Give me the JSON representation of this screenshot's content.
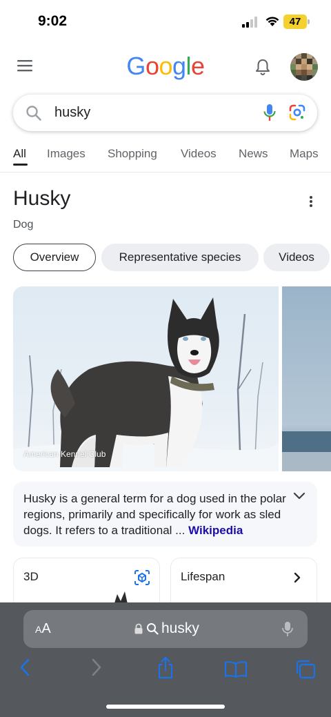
{
  "status_bar": {
    "time": "9:02",
    "battery": "47",
    "battery_color": "#f5d130"
  },
  "header": {
    "logo_letters": [
      "G",
      "o",
      "o",
      "g",
      "l",
      "e"
    ],
    "logo_colors": [
      "#4285f4",
      "#ea4335",
      "#fbbc05",
      "#4285f4",
      "#34a853",
      "#ea4335"
    ],
    "menu_icon": "hamburger-menu-icon",
    "notification_icon": "bell-icon",
    "avatar_icon": "profile-avatar"
  },
  "search": {
    "query": "husky",
    "search_icon": "magnifier-icon",
    "voice_icon": "microphone-icon",
    "lens_icon": "google-lens-icon"
  },
  "tabs": [
    {
      "label": "All",
      "active": true
    },
    {
      "label": "Images",
      "active": false
    },
    {
      "label": "Shopping",
      "active": false
    },
    {
      "label": "Videos",
      "active": false
    },
    {
      "label": "News",
      "active": false
    },
    {
      "label": "Maps",
      "active": false
    }
  ],
  "knowledge_panel": {
    "title": "Husky",
    "subtitle": "Dog",
    "chips": [
      {
        "label": "Overview",
        "selected": true
      },
      {
        "label": "Representative species",
        "selected": false
      },
      {
        "label": "Videos",
        "selected": false
      }
    ],
    "image_credit": "American Kennel Club",
    "description": "Husky is a general term for a dog used in the polar regions, primarily and specifically for work as sled dogs. It refers to a traditional",
    "description_ellipsis": " ... ",
    "source_link": "Wikipedia",
    "cards": [
      {
        "label": "3D"
      },
      {
        "label": "Lifespan"
      }
    ]
  },
  "safari": {
    "text_size_small": "A",
    "text_size_large": "A",
    "address": "husky",
    "accent_color": "#1a73e8"
  }
}
